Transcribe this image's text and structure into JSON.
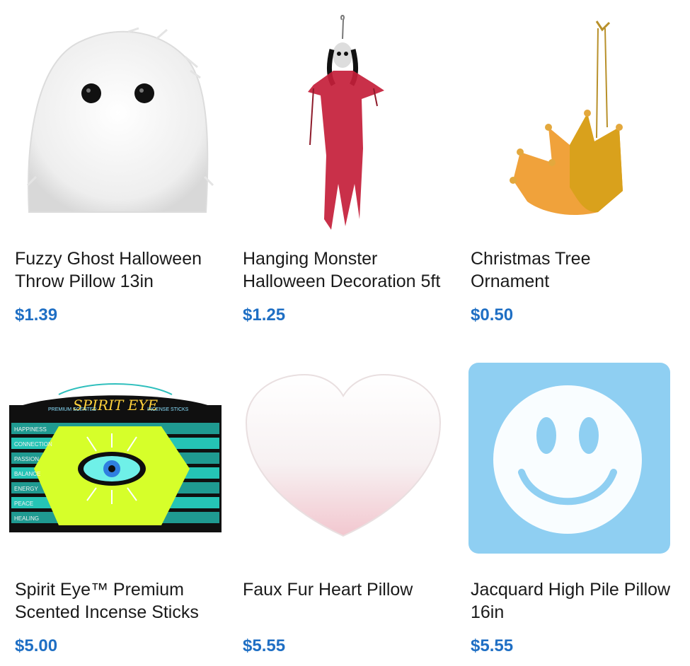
{
  "products": [
    {
      "name": "Fuzzy Ghost Halloween\nThrow Pillow 13in",
      "price": "$1.39",
      "image_icon": "ghost-pillow-image"
    },
    {
      "name": "Hanging Monster\nHalloween Decoration 5ft",
      "price": "$1.25",
      "image_icon": "hanging-monster-image"
    },
    {
      "name": "Christmas Tree\nOrnament",
      "price": "$0.50",
      "image_icon": "crown-ornament-image"
    },
    {
      "name": "Spirit Eye™ Premium\nScented Incense Sticks",
      "price": "$5.00",
      "image_icon": "incense-box-image",
      "box": {
        "brand": "SPIRIT EYE",
        "left_tag": "PREMIUM SCENTED",
        "right_tag": "INCENSE STICKS",
        "rows": [
          "HAPPINESS",
          "CONNECTION",
          "PASSION",
          "BALANCE",
          "ENERGY",
          "PEACE",
          "HEALING"
        ]
      }
    },
    {
      "name": "Faux Fur Heart Pillow",
      "price": "$5.55",
      "image_icon": "heart-pillow-image"
    },
    {
      "name": "Jacquard High Pile Pillow\n16in",
      "price": "$5.55",
      "image_icon": "smiley-pillow-image"
    }
  ],
  "colors": {
    "price": "#1f6fc4",
    "text": "#1a1a1a"
  }
}
